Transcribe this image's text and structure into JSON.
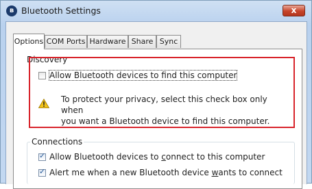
{
  "window": {
    "title": "Bluetooth Settings",
    "close_glyph": "x"
  },
  "tabs": [
    {
      "label": "Options",
      "active": true
    },
    {
      "label": "COM Ports",
      "active": false
    },
    {
      "label": "Hardware",
      "active": false
    },
    {
      "label": "Share",
      "active": false
    },
    {
      "label": "Sync",
      "active": false
    }
  ],
  "discovery": {
    "group_label": "Discovery",
    "allow_find": {
      "label": "Allow Bluetooth devices to find this computer",
      "checked": false
    },
    "warning_line1": "To protect your privacy, select this check box only when",
    "warning_line2": "you want a Bluetooth device to find this computer."
  },
  "connections": {
    "group_label": "Connections",
    "allow_connect": {
      "label_pre": "Allow Bluetooth devices to ",
      "label_key": "c",
      "label_post": "onnect to this computer",
      "checked": true
    },
    "alert_new": {
      "label_pre": "Alert me when a new Bluetooth device ",
      "label_key": "w",
      "label_post": "ants to connect",
      "checked": true
    }
  },
  "colors": {
    "highlight_box": "#d8232a",
    "close_button": "#c7442a",
    "warning_icon": "#f2c318"
  },
  "icons": {
    "title_icon": "bluetooth-icon",
    "warning": "warning-icon"
  }
}
